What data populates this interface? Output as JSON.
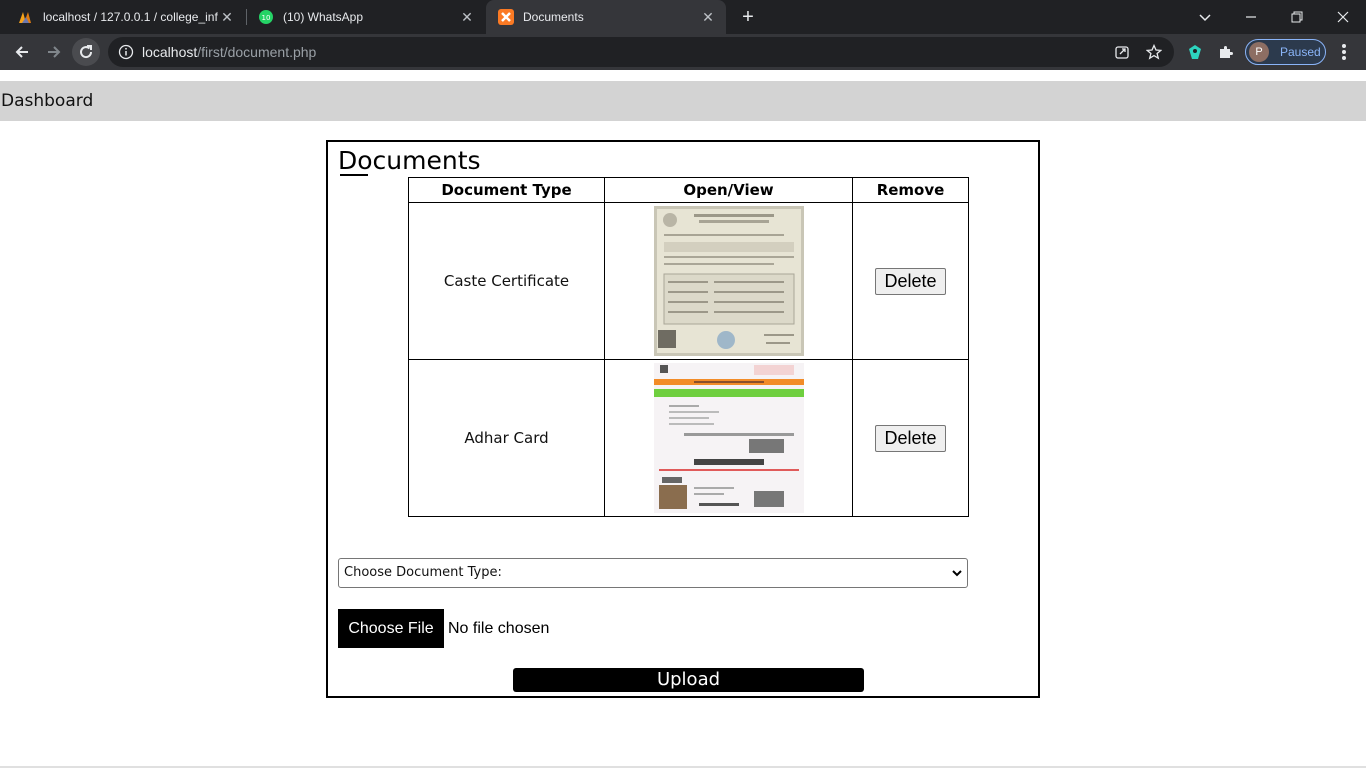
{
  "browser": {
    "tabs": [
      {
        "title": "localhost / 127.0.0.1 / college_inf",
        "icon": "phpmyadmin-icon",
        "active": false
      },
      {
        "title": "(10) WhatsApp",
        "icon": "whatsapp-icon",
        "active": false
      },
      {
        "title": "Documents",
        "icon": "xampp-icon",
        "active": true
      }
    ],
    "url_host": "localhost",
    "url_path": "/first/document.php",
    "profile_initial": "P",
    "profile_status": "Paused",
    "colors": {
      "tabbar": "#202124",
      "toolbar": "#35363a",
      "accent": "#8ab4f8"
    }
  },
  "page": {
    "header": "Dashboard",
    "title": "Documents",
    "table": {
      "headers": [
        "Document Type",
        "Open/View",
        "Remove"
      ],
      "rows": [
        {
          "type": "Caste Certificate",
          "thumbnail": "caste-certificate-image",
          "action": "Delete"
        },
        {
          "type": "Adhar Card",
          "thumbnail": "adhar-card-image",
          "action": "Delete"
        }
      ]
    },
    "select_placeholder": "Choose Document Type:",
    "file_button": "Choose File",
    "file_status": "No file chosen",
    "upload_button": "Upload"
  }
}
